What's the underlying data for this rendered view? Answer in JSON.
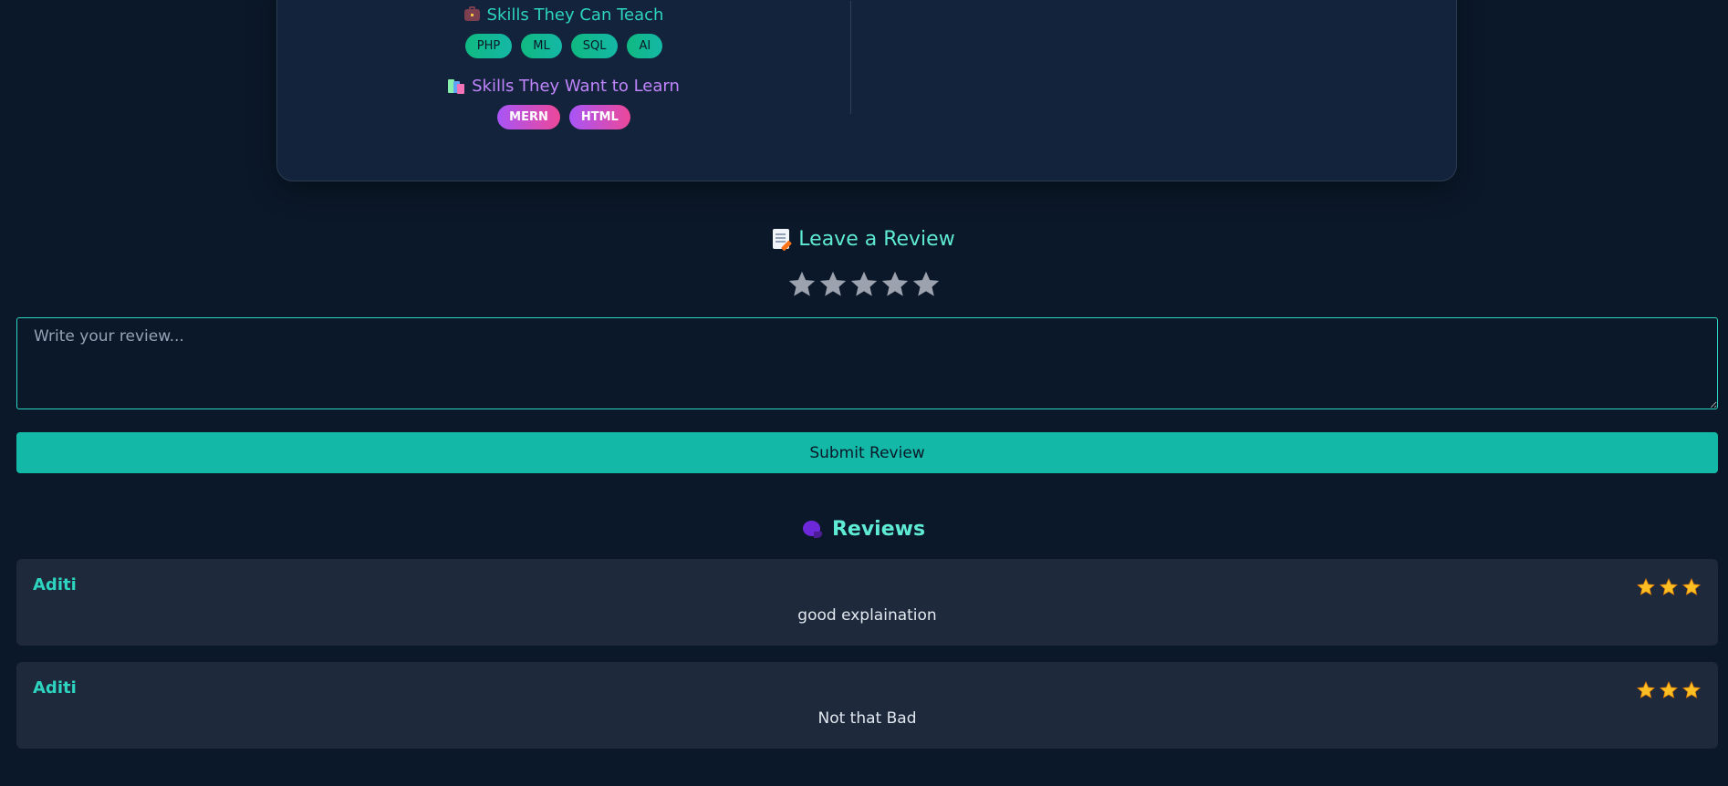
{
  "profile": {
    "teach_heading": "Skills They Can Teach",
    "teach_skills": [
      "PHP",
      "ML",
      "SQL",
      "AI"
    ],
    "learn_heading": "Skills They Want to Learn",
    "learn_skills": [
      "MERN",
      "HTML"
    ]
  },
  "leave_review": {
    "heading": "Leave a Review",
    "icon": "memo-icon",
    "rating_max": 5,
    "rating_selected": 0,
    "placeholder": "Write your review...",
    "value": "",
    "submit_label": "Submit Review"
  },
  "reviews": {
    "heading": "Reviews",
    "icon": "speech-balloon-icon",
    "items": [
      {
        "author": "Aditi",
        "rating": 3,
        "text": "good explaination"
      },
      {
        "author": "Aditi",
        "rating": 3,
        "text": "Not that Bad"
      }
    ]
  },
  "colors": {
    "background": "#0b1829",
    "accent": "#14b8a6",
    "accent_text": "#2dd4bf",
    "learn_accent": "#c084fc",
    "star_filled": "#fbbf24",
    "star_empty": "#9ca3af",
    "card": "#1e293b"
  }
}
